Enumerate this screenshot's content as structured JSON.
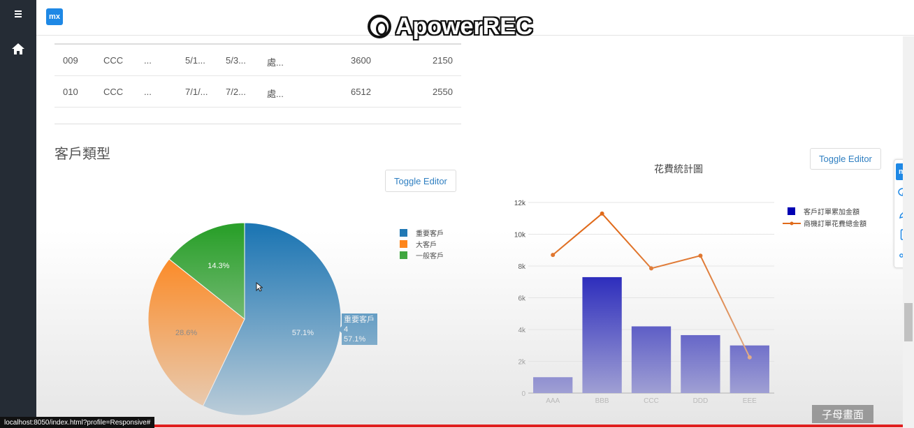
{
  "app": {
    "logo_text": "mx"
  },
  "watermark": {
    "text": "ApowerREC"
  },
  "sidebar": {
    "items": [
      {
        "icon": "menu-icon"
      },
      {
        "icon": "home-icon"
      }
    ]
  },
  "table": {
    "rows": [
      {
        "c1": "009",
        "c2": "CCC",
        "c3": "...",
        "c4": "5/1...",
        "c5": "5/3...",
        "c6": "處...",
        "c7": "3600",
        "c8": "2150"
      },
      {
        "c1": "010",
        "c2": "CCC",
        "c3": "...",
        "c4": "7/1/...",
        "c5": "7/2...",
        "c6": "處...",
        "c7": "6512",
        "c8": "2550"
      }
    ]
  },
  "pie_section": {
    "title": "客戶類型",
    "toggle_label": "Toggle Editor"
  },
  "bar_section": {
    "toggle_label": "Toggle Editor"
  },
  "tooltip": {
    "label": "重要客戶",
    "count": "4",
    "percent": "57.1%"
  },
  "colors": {
    "pie_important": "#1f77b4",
    "pie_large": "#ff7f0e",
    "pie_general": "#2ca02c",
    "bar": "#0000b3",
    "line": "#e06a1a",
    "accent": "#2f7fc1"
  },
  "chart_data": [
    {
      "type": "pie",
      "labels": [
        "重要客戶",
        "大客戶",
        "一般客戶"
      ],
      "values": [
        57.1,
        28.6,
        14.3
      ],
      "slice_labels": [
        "57.1%",
        "28.6%",
        "14.3%"
      ],
      "legend_placement": "top-right"
    },
    {
      "type": "bar",
      "title": "花費統計圖",
      "categories": [
        "AAA",
        "BBB",
        "CCC",
        "DDD",
        "EEE"
      ],
      "series": [
        {
          "name": "客戶訂單累加金額",
          "type": "bar",
          "values": [
            1000,
            7300,
            4200,
            3650,
            3000
          ]
        },
        {
          "name": "商機訂單花費總金額",
          "type": "line",
          "values": [
            8700,
            11300,
            7850,
            8650,
            2250
          ]
        }
      ],
      "ylim": [
        0,
        12000
      ],
      "yticks": [
        "0",
        "2k",
        "4k",
        "6k",
        "8k",
        "10k",
        "12k"
      ],
      "grid": true,
      "legend_placement": "top-right"
    }
  ],
  "float_toolbar": {
    "logo_text": "mx",
    "icons": [
      "chat-icon",
      "pencil-icon",
      "phone-icon",
      "share-icon"
    ]
  },
  "status_bar": {
    "url": "localhost:8050/index.html?profile=Responsive#"
  },
  "subtitle_label": "子母畫面"
}
